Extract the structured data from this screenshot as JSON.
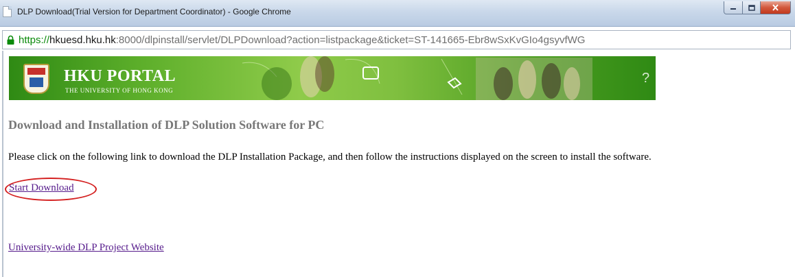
{
  "window": {
    "title": "DLP Download(Trial Version for Department Coordinator) - Google Chrome",
    "controls": {
      "minimize_icon": "minimize-icon",
      "maximize_icon": "maximize-icon",
      "close_icon": "close-icon"
    }
  },
  "address_bar": {
    "scheme": "https://",
    "host": "hkuesd.hku.hk",
    "rest": ":8000/dlpinstall/servlet/DLPDownload?action=listpackage&ticket=ST-141665-Ebr8wSxKvGIo4gsyvfWG",
    "secure_icon": "lock-icon",
    "secure_color": "#0a8a0a"
  },
  "banner": {
    "title": "HKU PORTAL",
    "subtitle": "THE UNIVERSITY OF HONG KONG",
    "crest_icon": "university-crest-icon",
    "background_color": "#5cae2a"
  },
  "page": {
    "heading": "Download and Installation of DLP Solution Software for PC",
    "instruction": "Please click on the following link to download the DLP Installation Package, and then follow the instructions displayed on the screen to install the software.",
    "start_download": "Start Download",
    "project_website": "University-wide DLP Project Website",
    "link_color": "#551a8b",
    "highlight_color": "#d42020"
  }
}
